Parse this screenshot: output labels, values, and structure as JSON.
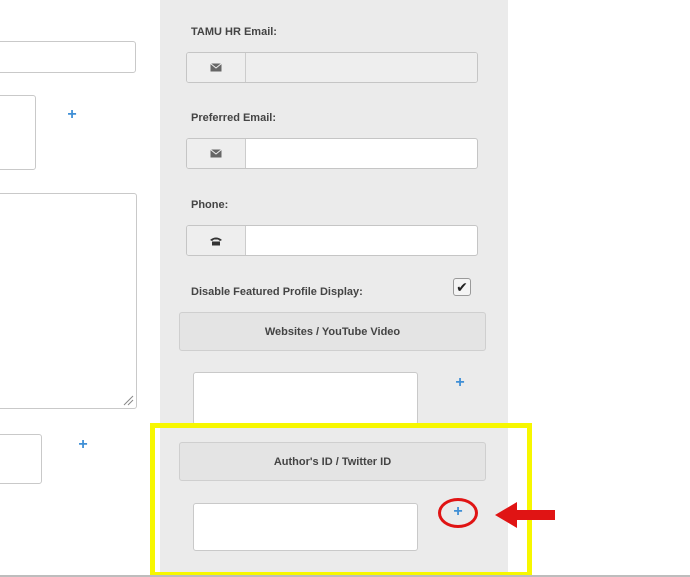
{
  "form": {
    "tamu_email_label": "TAMU HR Email:",
    "tamu_email_value": "",
    "preferred_email_label": "Preferred Email:",
    "preferred_email_value": "",
    "phone_label": "Phone:",
    "phone_value": "",
    "disable_featured_label": "Disable Featured Profile Display:",
    "disable_featured_checked": true,
    "disable_featured_mark": "✔",
    "websites_button": "Websites / YouTube Video",
    "authors_button": "Author's ID / Twitter ID",
    "plus_glyph": "+"
  },
  "icons": {
    "email": "envelope-icon",
    "phone": "phone-icon",
    "add": "plus-icon",
    "arrow": "arrow-left-icon"
  },
  "colors": {
    "highlight": "#f7f700",
    "annotation_red": "#e01414",
    "plus_blue": "#3f8fd6"
  }
}
